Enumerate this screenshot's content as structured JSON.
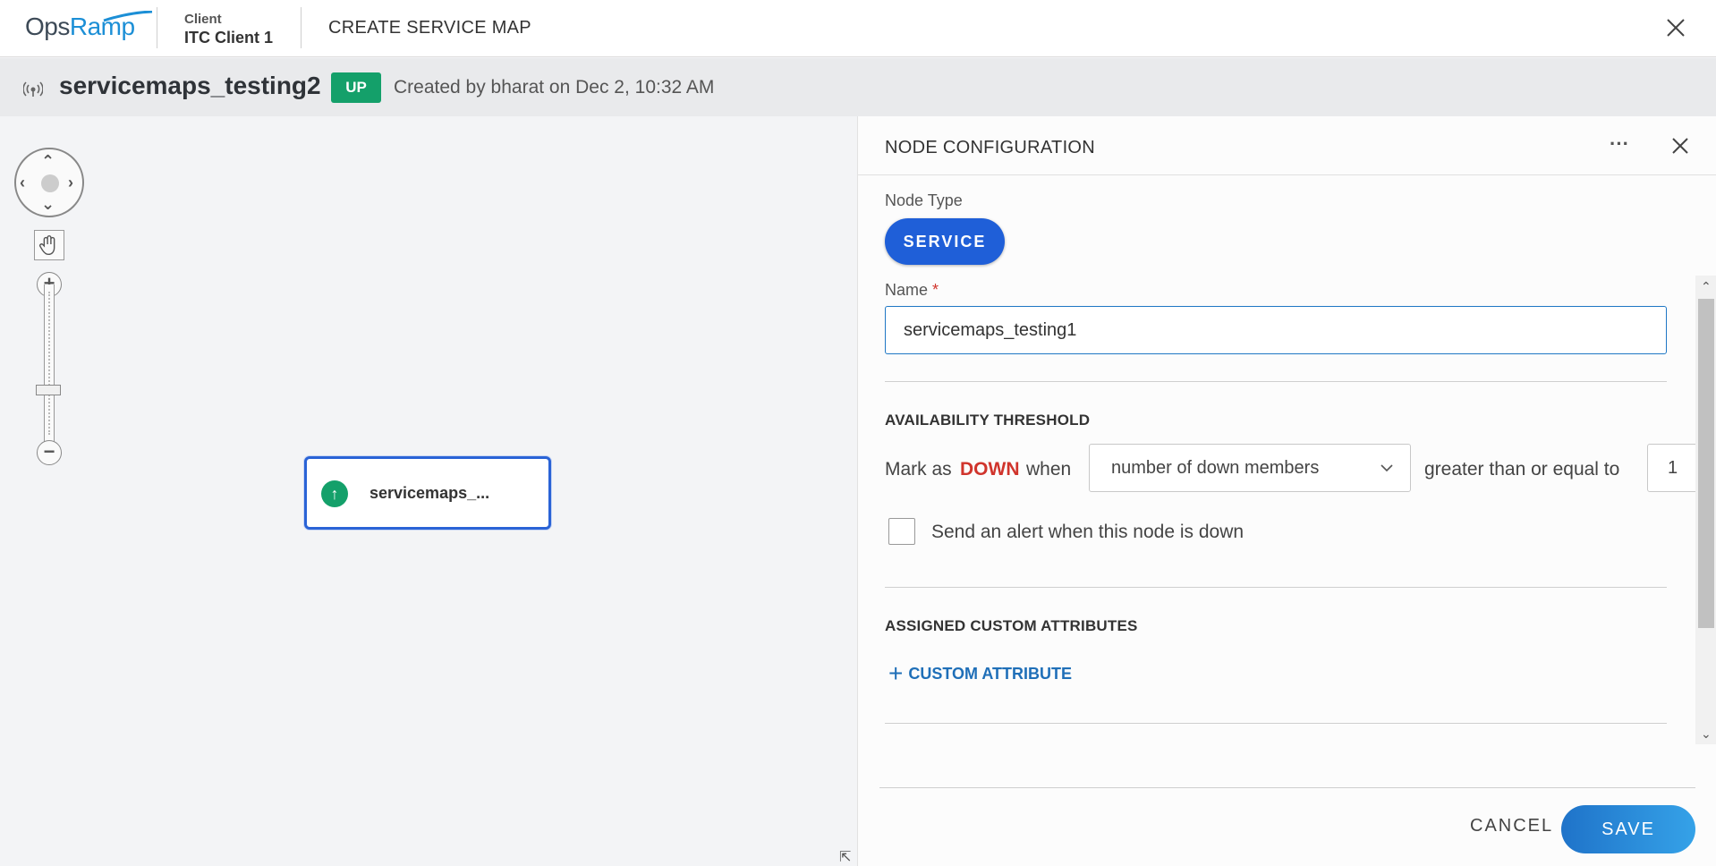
{
  "topbar": {
    "logo_ops": "Ops",
    "logo_ramp": "Ramp",
    "client_label": "Client",
    "client_name": "ITC Client 1",
    "page_title": "CREATE SERVICE MAP"
  },
  "map": {
    "name": "servicemaps_testing2",
    "status": "UP",
    "created": "Created by bharat on Dec 2, 10:32 AM"
  },
  "canvas": {
    "node_label": "servicemaps_..."
  },
  "panel": {
    "title": "NODE CONFIGURATION",
    "more": "···",
    "node_type_label": "Node Type",
    "node_type_value": "SERVICE",
    "name_label": "Name",
    "name_required": "*",
    "name_value": "servicemaps_testing1",
    "availability_title": "AVAILABILITY THRESHOLD",
    "mark_as": "Mark as",
    "down_word": "DOWN",
    "when": "when",
    "condition_selected": "number of down members",
    "comparator": "greater than or equal to",
    "threshold_value": "1",
    "alert_checkbox_label": "Send an alert when this node is down",
    "alert_checked": false,
    "custom_attr_title": "ASSIGNED CUSTOM ATTRIBUTES",
    "add_custom_attr": "CUSTOM ATTRIBUTE",
    "cancel": "CANCEL",
    "save": "SAVE"
  },
  "colors": {
    "brand_blue": "#1c8fd6",
    "status_up": "#14a06a",
    "service_pill": "#1f5fd8",
    "down_red": "#d0342c",
    "link_blue": "#1f6fb8"
  }
}
